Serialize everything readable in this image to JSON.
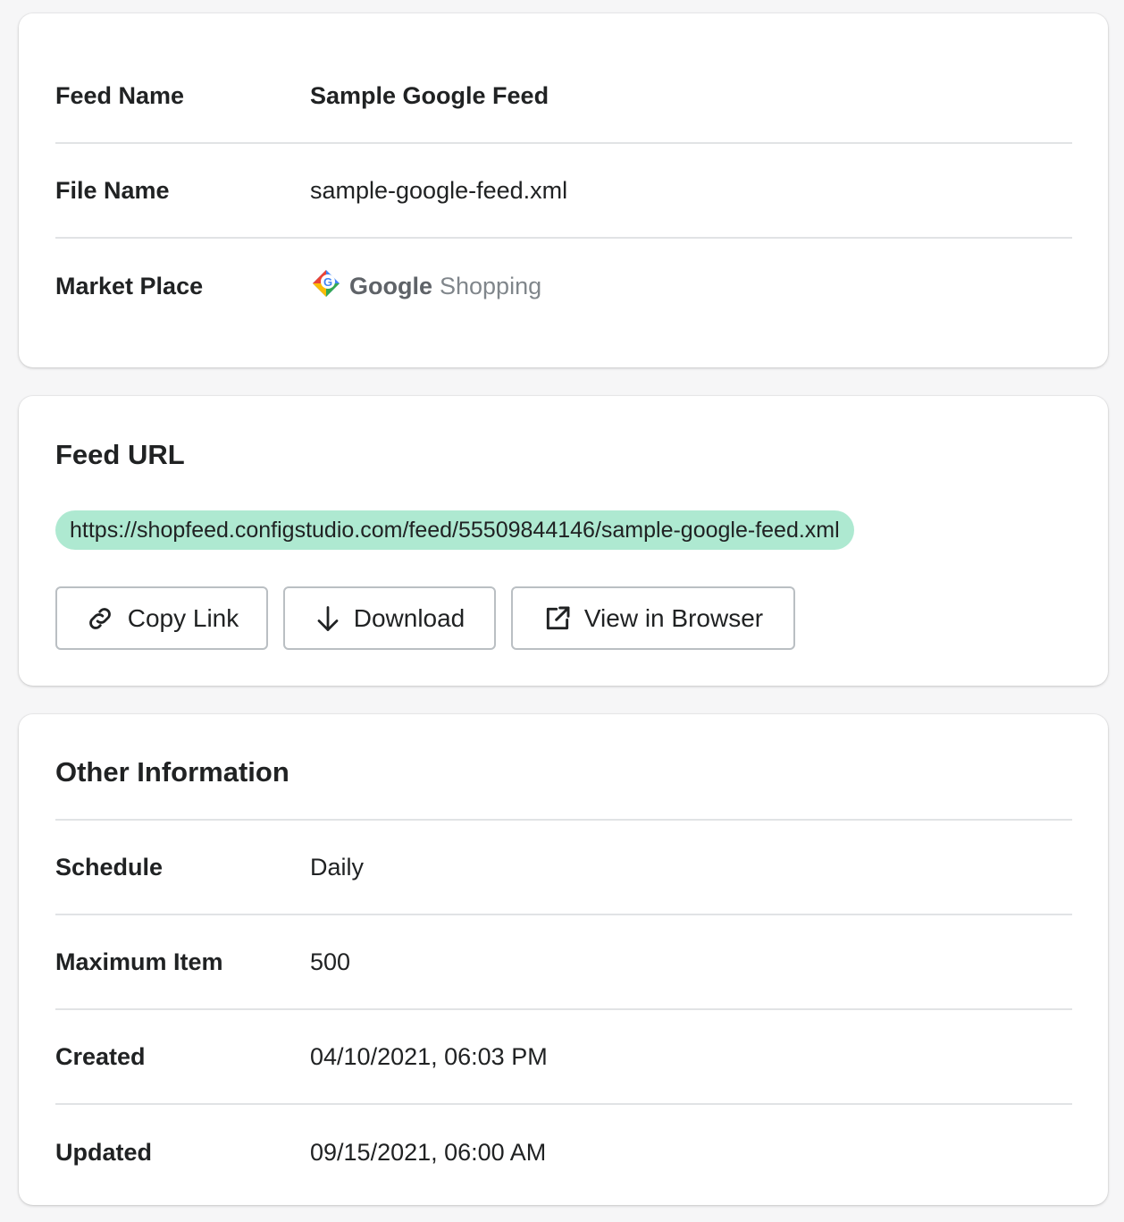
{
  "details": {
    "feed_name_label": "Feed Name",
    "feed_name_value": "Sample Google Feed",
    "file_name_label": "File Name",
    "file_name_value": "sample-google-feed.xml",
    "market_place_label": "Market Place",
    "market_place_brand": "Google",
    "market_place_product": "Shopping",
    "market_place_icon": "google-shopping-tag-icon"
  },
  "feed_url": {
    "title": "Feed URL",
    "url": "https://shopfeed.configstudio.com/feed/55509844146/sample-google-feed.xml",
    "pill_color": "#aee9d1",
    "buttons": {
      "copy_label": "Copy Link",
      "copy_icon": "link-icon",
      "download_label": "Download",
      "download_icon": "arrow-down-icon",
      "view_label": "View in Browser",
      "view_icon": "external-link-icon"
    }
  },
  "other": {
    "title": "Other Information",
    "rows": [
      {
        "label": "Schedule",
        "value": "Daily"
      },
      {
        "label": "Maximum Item",
        "value": "500"
      },
      {
        "label": "Created",
        "value": "04/10/2021, 06:03 PM"
      },
      {
        "label": "Updated",
        "value": "09/15/2021, 06:00 AM"
      }
    ]
  }
}
